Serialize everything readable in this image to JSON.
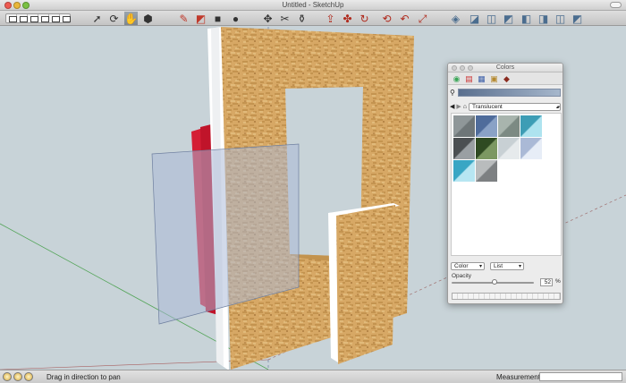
{
  "window": {
    "title": "Untitled - SketchUp"
  },
  "toolbar": {
    "view_group": [
      "iso-view-icon",
      "top-view-icon",
      "front-view-icon",
      "right-view-icon",
      "back-view-icon",
      "left-view-icon"
    ],
    "tools": [
      {
        "name": "select-arrow-icon",
        "glyph": "➚"
      },
      {
        "name": "orbit-icon",
        "glyph": "⟳"
      },
      {
        "name": "pan-hand-icon",
        "glyph": "✋"
      },
      {
        "name": "zoom-extents-icon",
        "glyph": "⬢"
      },
      {
        "name": "pencil-icon",
        "glyph": "✎"
      },
      {
        "name": "eraser-icon",
        "glyph": "◩"
      },
      {
        "name": "rectangle-icon",
        "glyph": "■"
      },
      {
        "name": "circle-icon",
        "glyph": "●"
      },
      {
        "name": "move-icon",
        "glyph": "✥"
      },
      {
        "name": "tape-measure-icon",
        "glyph": "✂"
      },
      {
        "name": "paint-bucket-icon",
        "glyph": "⚱"
      },
      {
        "name": "push-pull-icon",
        "glyph": "⇪"
      },
      {
        "name": "rotate-icon",
        "glyph": "✤"
      },
      {
        "name": "follow-me-icon",
        "glyph": "↻"
      },
      {
        "name": "offset-icon",
        "glyph": "⟲"
      },
      {
        "name": "scale-icon",
        "glyph": "↶"
      },
      {
        "name": "components-icon",
        "glyph": "⤢"
      },
      {
        "name": "section-plane-icon",
        "glyph": "◈"
      },
      {
        "name": "layer-1-icon",
        "glyph": "◪"
      },
      {
        "name": "layer-2-icon",
        "glyph": "◫"
      },
      {
        "name": "layer-3-icon",
        "glyph": "◩"
      },
      {
        "name": "layer-4-icon",
        "glyph": "◧"
      },
      {
        "name": "layer-5-icon",
        "glyph": "◨"
      },
      {
        "name": "layer-6-icon",
        "glyph": "◫"
      },
      {
        "name": "layer-7-icon",
        "glyph": "◩"
      }
    ]
  },
  "status": {
    "hint": "Drag in direction to pan",
    "measurements_label": "Measurements",
    "measurements_value": ""
  },
  "colors_panel": {
    "title": "Colors",
    "library": "Translucent",
    "mode": "Color",
    "view": "List",
    "opacity_label": "Opacity",
    "opacity": "52",
    "opacity_unit": "%",
    "swatches": [
      {
        "name": "tile-gray-checker",
        "color": "#8f9799",
        "color2": "#6e7678"
      },
      {
        "name": "glass-blue-striped",
        "color": "#4f6c9b",
        "color2": "#8aa2c6"
      },
      {
        "name": "glass-green-gray",
        "color": "#a8b4ad",
        "color2": "#7c8a83"
      },
      {
        "name": "glass-teal",
        "color": "#3d9db5",
        "color2": "#aee3ef"
      },
      {
        "name": "glass-smoke",
        "color": "#4b4f52",
        "color2": "#9a9fa3"
      },
      {
        "name": "glass-dark-green",
        "color": "#2f4a22",
        "color2": "#7c9862"
      },
      {
        "name": "glass-light-gray",
        "color": "#c8d0d4",
        "color2": "#e6eaec"
      },
      {
        "name": "glass-pale-blue",
        "color": "#aab9d6",
        "color2": "#e7edf7"
      },
      {
        "name": "glass-cyan",
        "color": "#39a6c4",
        "color2": "#b7e6f2"
      },
      {
        "name": "glass-speckled",
        "color": "#b9bcbd",
        "color2": "#7d8082"
      }
    ]
  }
}
